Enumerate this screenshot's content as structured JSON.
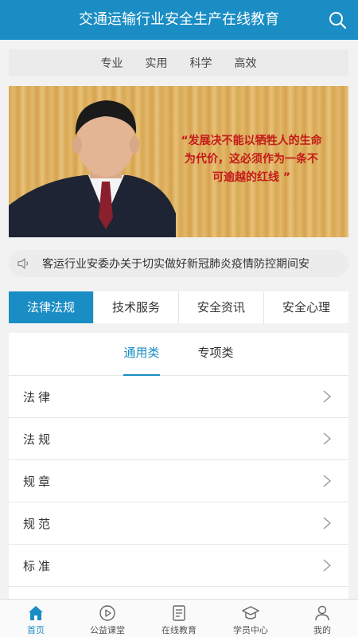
{
  "header": {
    "title": "交通运输行业安全生产在线教育",
    "search_icon": "search-icon"
  },
  "slogans": [
    "专业",
    "实用",
    "科学",
    "高效"
  ],
  "banner": {
    "quote_lines": [
      "“发展决不能以牺牲人的生命",
      "为代价，这必须作为一条不",
      "可逾越的红线 ”"
    ]
  },
  "notice": {
    "text": "客运行业安委办关于切实做好新冠肺炎疫情防控期间安",
    "icon": "speaker-icon"
  },
  "categories": [
    {
      "label": "法律法规",
      "active": true
    },
    {
      "label": "技术服务",
      "active": false
    },
    {
      "label": "安全资讯",
      "active": false
    },
    {
      "label": "安全心理",
      "active": false
    }
  ],
  "subtabs": [
    {
      "label": "通用类",
      "active": true
    },
    {
      "label": "专项类",
      "active": false
    }
  ],
  "list": [
    "法律",
    "法规",
    "规章",
    "规范",
    "标准"
  ],
  "bottom_nav": [
    {
      "label": "首页",
      "icon": "home-icon",
      "active": true
    },
    {
      "label": "公益课堂",
      "icon": "play-circle-icon",
      "active": false
    },
    {
      "label": "在线教育",
      "icon": "document-icon",
      "active": false
    },
    {
      "label": "学员中心",
      "icon": "graduation-cap-icon",
      "active": false
    },
    {
      "label": "我的",
      "icon": "user-icon",
      "active": false
    }
  ],
  "colors": {
    "accent": "#1a8dc4",
    "quote_red": "#c41a1a"
  }
}
